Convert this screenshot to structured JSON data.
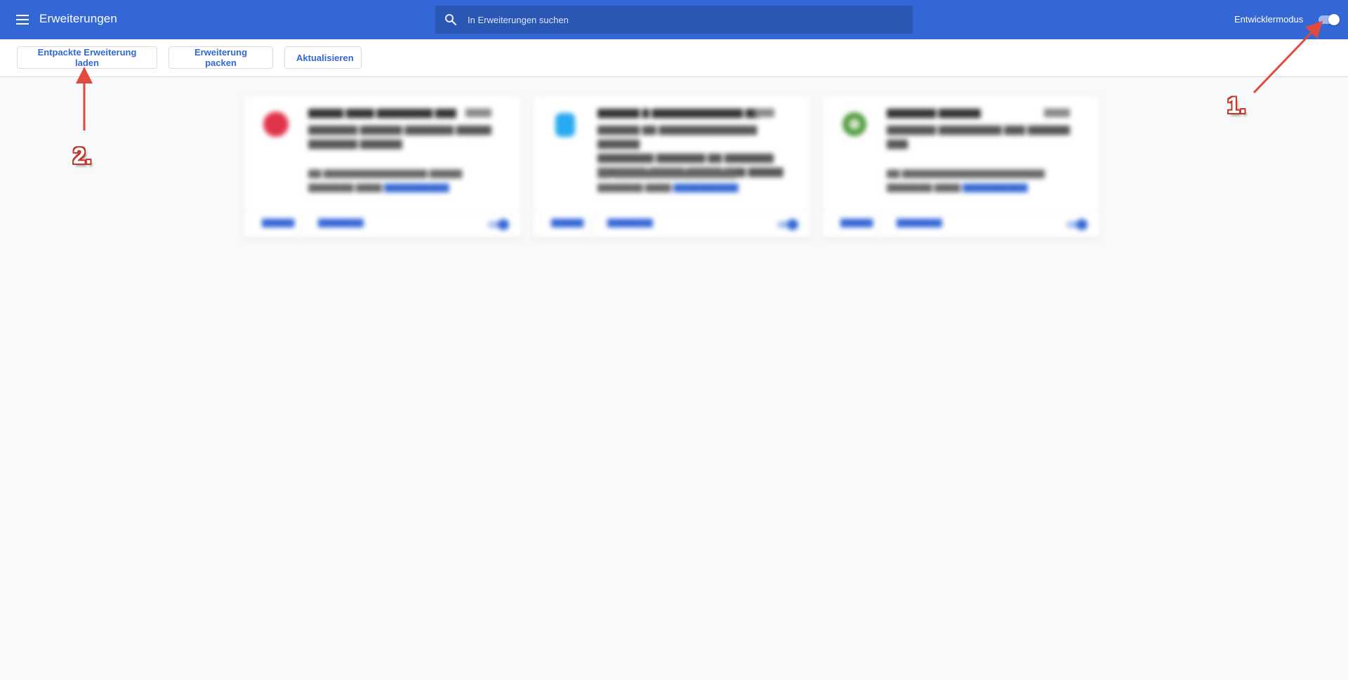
{
  "header": {
    "title": "Erweiterungen",
    "search_placeholder": "In Erweiterungen suchen",
    "devmode_label": "Entwicklermodus",
    "devmode_enabled": true
  },
  "toolbar": {
    "load_unpacked": "Entpackte Erweiterung laden",
    "pack": "Erweiterung packen",
    "update": "Aktualisieren"
  },
  "annotations": {
    "step1": "1.",
    "step2": "2."
  },
  "colors": {
    "appbar": "#3367d6",
    "search_bg": "#2a56b4",
    "accent": "#3367d6",
    "annotation": "#e04a3f"
  }
}
